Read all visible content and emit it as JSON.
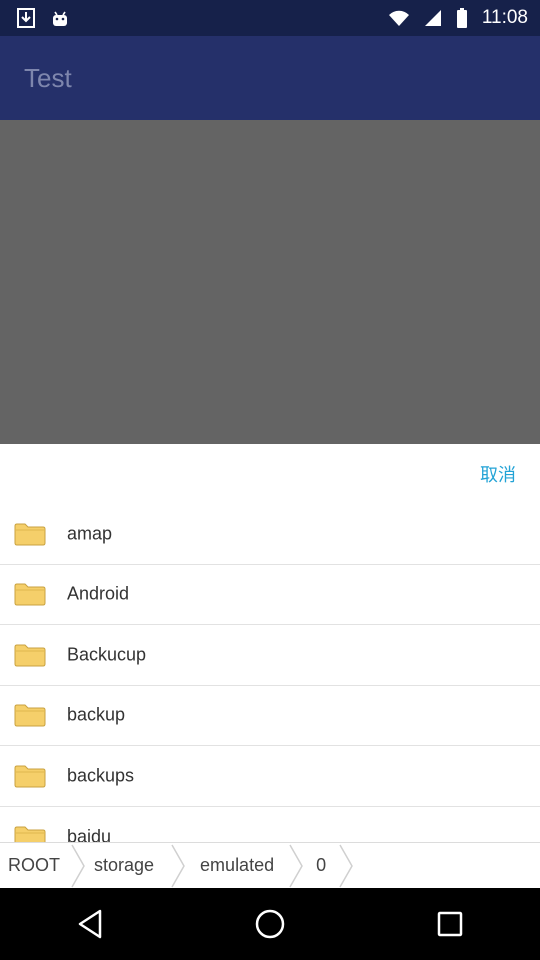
{
  "status_bar": {
    "time": "11:08"
  },
  "app_bar": {
    "title": "Test"
  },
  "sheet": {
    "cancel_label": "取消",
    "items": [
      {
        "name": "amap"
      },
      {
        "name": "Android"
      },
      {
        "name": "Backucup"
      },
      {
        "name": "backup"
      },
      {
        "name": "backups"
      },
      {
        "name": "baidu"
      }
    ]
  },
  "breadcrumb": [
    "ROOT",
    "storage",
    "emulated",
    "0"
  ],
  "icons": {
    "folder": "folder-icon",
    "download": "download-icon",
    "android": "android-icon",
    "wifi": "wifi-icon",
    "signal": "signal-icon",
    "battery": "battery-icon",
    "back": "back-icon",
    "home": "home-icon",
    "recents": "recents-icon"
  },
  "colors": {
    "accent": "#23a3d6",
    "app_bar": "#25306a",
    "status_bar": "#16214a",
    "folder": "#f5cf6a"
  }
}
